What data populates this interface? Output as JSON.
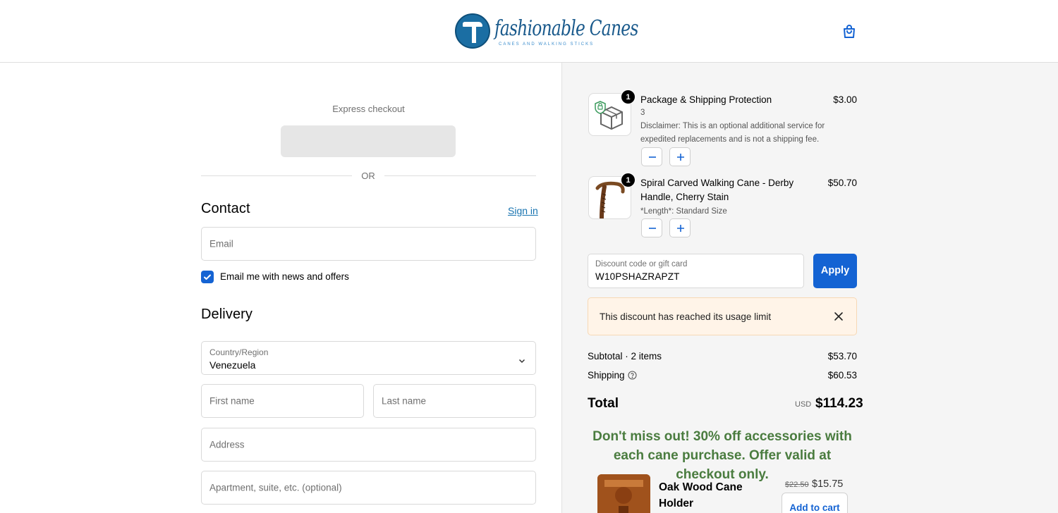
{
  "brand": {
    "name": "fashionable Canes",
    "tagline": "CANES AND WALKING STICKS"
  },
  "express": {
    "label": "Express checkout",
    "or_text": "OR"
  },
  "contact": {
    "title": "Contact",
    "sign_in_label": "Sign in",
    "email_placeholder": "Email",
    "news_checkbox_label": "Email me with news and offers",
    "news_checked": true
  },
  "delivery": {
    "title": "Delivery",
    "country_label": "Country/Region",
    "country_value": "Venezuela",
    "first_name_placeholder": "First name",
    "last_name_placeholder": "Last name",
    "address_placeholder": "Address",
    "apartment_placeholder": "Apartment, suite, etc. (optional)"
  },
  "cart": {
    "items": [
      {
        "name": "Package & Shipping Protection",
        "variant": "3",
        "note": "Disclaimer: This is an optional additional service for expedited replacements and is not a shipping fee.",
        "quantity": "1",
        "price": "$3.00",
        "icon": "package-shield-icon"
      },
      {
        "name": "Spiral Carved Walking Cane - Derby Handle, Cherry Stain",
        "variant": "*Length*: Standard Size",
        "quantity": "1",
        "price": "$50.70",
        "icon": "cane-image"
      }
    ]
  },
  "discount": {
    "label": "Discount code or gift card",
    "value": "W10PSHAZRAPZT",
    "apply_label": "Apply",
    "alert_text": "This discount has reached its usage limit"
  },
  "summary": {
    "subtotal_label": "Subtotal · 2 items",
    "subtotal_value": "$53.70",
    "shipping_label": "Shipping",
    "shipping_value": "$60.53",
    "total_label": "Total",
    "currency": "USD",
    "total_value": "$114.23"
  },
  "promo": {
    "text": "Don't miss out! 30% off accessories with each cane purchase. Offer valid at checkout only."
  },
  "upsell": {
    "name": "Oak Wood Cane Holder",
    "old_price": "$22.50",
    "new_price": "$15.75",
    "button_label": "Add to cart"
  },
  "colors": {
    "accent": "#1463d3",
    "link": "#1773b0",
    "promo_green": "#4a7c3f",
    "alert_bg": "#fff4e8",
    "panel_bg": "#f5f5f5"
  }
}
